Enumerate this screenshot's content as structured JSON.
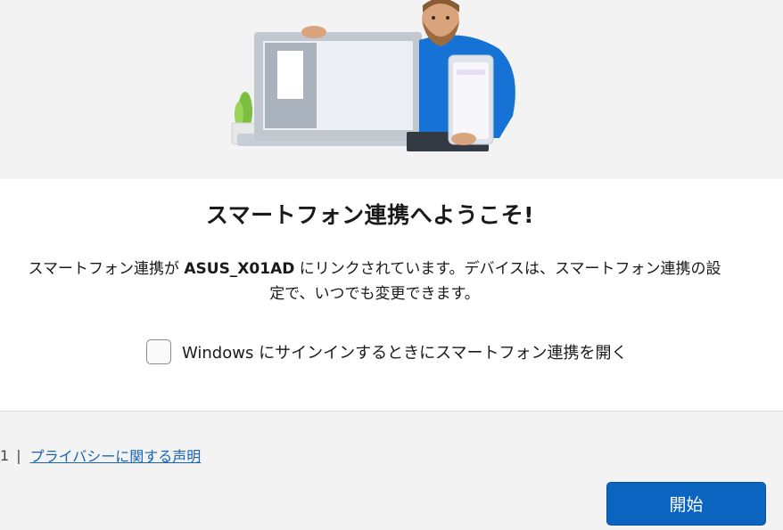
{
  "header": {
    "title": "スマートフォン連携へようこそ!",
    "illustration_icon": "person-with-laptop-and-phone-illustration"
  },
  "description": {
    "prefix": "スマートフォン連携が",
    "device_name": "ASUS_X01AD",
    "suffix_line1": "にリンクされています。デバイスは、スマートフォン連携の設",
    "line2": "定で、いつでも変更できます。"
  },
  "startup_option": {
    "label": "Windows にサインインするときにスマートフォン連携を開く",
    "checked": false
  },
  "footer": {
    "partial_text": "1",
    "separator": "|",
    "privacy_link": "プライバシーに関する声明",
    "start_button": "開始"
  },
  "colors": {
    "accent": "#0a64c0",
    "hero_background": "#f3f3f3",
    "link": "#1a63b0"
  }
}
